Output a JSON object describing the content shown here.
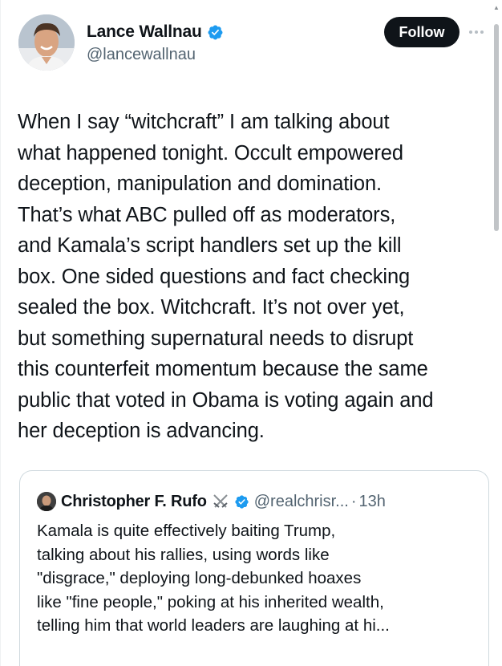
{
  "author": {
    "display_name": "Lance Wallnau",
    "handle": "@lancewallnau",
    "avatar_icon": "profile-photo",
    "verified_icon": "verified-badge-icon"
  },
  "actions": {
    "follow_label": "Follow",
    "more_icon": "more-options-icon"
  },
  "tweet": {
    "text": "When I say “witchcraft” I am talking about\nwhat happened tonight. Occult empowered\ndeception, manipulation and domination.\nThat’s what ABC pulled off as moderators,\nand Kamala’s script handlers set up the kill\nbox. One sided questions and fact checking\nsealed the box. Witchcraft. It’s not over yet,\nbut something supernatural needs to disrupt\nthis counterfeit momentum because the same\npublic that voted in Obama is voting again and\nher deception is advancing."
  },
  "quote": {
    "display_name": "Christopher F. Rufo",
    "emoji_icon": "crossed-swords-icon",
    "handle": "@realchrisr...",
    "separator": "·",
    "time": "13h",
    "text": "Kamala is quite effectively baiting Trump,\ntalking about his rallies, using words like\n\"disgrace,\" deploying long-debunked hoaxes\nlike \"fine people,\" poking at his inherited wealth,\ntelling him that world leaders are laughing at hi..."
  },
  "colors": {
    "text_primary": "#0f1419",
    "text_secondary": "#536471",
    "verified_blue": "#1d9bf0",
    "button_bg": "#0f1419",
    "border": "#cfd9de"
  }
}
